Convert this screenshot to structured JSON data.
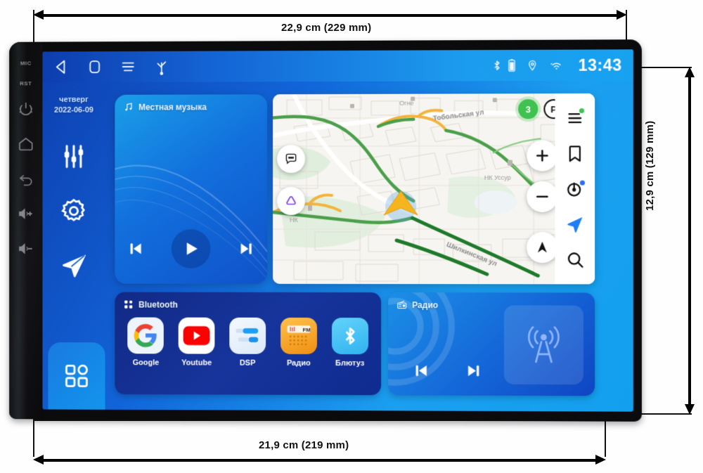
{
  "annotations": {
    "width_top": "22,9 cm (229 mm)",
    "width_bottom": "21,9 cm (219 mm)",
    "height_right": "12,9 cm (129 mm)"
  },
  "device": {
    "hardware_labels": {
      "mic": "MIC",
      "reset": "RST"
    },
    "hardware_buttons": [
      {
        "name": "power-button",
        "icon": "power-icon"
      },
      {
        "name": "home-button",
        "icon": "home-icon"
      },
      {
        "name": "back-button",
        "icon": "back-arrow-icon"
      },
      {
        "name": "volume-up-button",
        "icon": "volume-plus-icon"
      },
      {
        "name": "volume-down-button",
        "icon": "volume-minus-icon"
      }
    ]
  },
  "statusbar": {
    "nav_icons": [
      "back-icon",
      "home-icon",
      "menu-icon",
      "usb-icon"
    ],
    "tray_icons": [
      "bluetooth-icon",
      "battery-icon",
      "location-icon",
      "wifi-icon"
    ],
    "clock": "13:43"
  },
  "rail": {
    "date": {
      "weekday": "четверг",
      "date": "2022-06-09"
    },
    "icons": [
      "equalizer-icon",
      "settings-gear-icon",
      "navigation-arrow-icon"
    ],
    "app_drawer": "apps-grid-icon"
  },
  "music_widget": {
    "title": "Местная музыка",
    "header_icon": "music-note-icon",
    "controls": [
      {
        "name": "previous-track-button",
        "icon": "skip-previous-icon"
      },
      {
        "name": "play-button",
        "icon": "play-icon"
      },
      {
        "name": "next-track-button",
        "icon": "skip-next-icon"
      }
    ]
  },
  "map_widget": {
    "streets": [
      "Тобольская ул",
      "Шилкинская ул"
    ],
    "pois": [
      "НК Уссур",
      "НК",
      "Огне"
    ],
    "traffic_badge": "3",
    "parking_badge": "P",
    "left_buttons": [
      {
        "name": "chat-button",
        "icon": "chat-bubble-icon"
      },
      {
        "name": "layers-button",
        "icon": "triangle-rounded-icon"
      }
    ],
    "zoom_buttons": [
      {
        "name": "zoom-in-button",
        "icon": "plus-icon"
      },
      {
        "name": "zoom-out-button",
        "icon": "minus-icon"
      }
    ],
    "compass_button": {
      "name": "compass-button",
      "icon": "compass-arrow-icon"
    },
    "rail_buttons": [
      {
        "name": "menu-button",
        "icon": "menu-lines-icon",
        "badge_color": "#3fc24f"
      },
      {
        "name": "bookmarks-button",
        "icon": "bookmark-icon"
      },
      {
        "name": "alice-assistant-button",
        "icon": "alice-icon",
        "badge_color": "#2b6df5"
      },
      {
        "name": "navigate-button",
        "icon": "navigation-arrow-icon",
        "color": "#1f7ef5"
      },
      {
        "name": "search-button",
        "icon": "search-icon"
      }
    ]
  },
  "apps_widget": {
    "title": "Bluetooth",
    "header_icon": "apps-dots-icon",
    "apps": [
      {
        "label": "Google",
        "icon": "google-icon",
        "bg": "#eef4fb"
      },
      {
        "label": "Youtube",
        "icon": "youtube-icon",
        "bg": "#ffffff"
      },
      {
        "label": "DSP",
        "icon": "dsp-icon",
        "bg": "#e9f2fb"
      },
      {
        "label": "Радио",
        "icon": "fm-radio-icon",
        "bg": "#f5a623"
      },
      {
        "label": "Блютуз",
        "icon": "bluetooth-icon",
        "bg": "#4cc3f5"
      }
    ]
  },
  "radio_widget": {
    "title": "Радио",
    "header_icon": "radio-icon",
    "controls": [
      {
        "name": "radio-previous-button",
        "icon": "skip-previous-icon"
      },
      {
        "name": "radio-next-button",
        "icon": "skip-next-icon"
      }
    ],
    "tower_icon": "radio-tower-icon"
  },
  "colors": {
    "screen_blue_dark": "#0e3fb0",
    "screen_blue_light": "#17a2f0",
    "apps_panel": "#16349b",
    "traffic_green": "#3fc24f",
    "accent_blue": "#1f7ef5",
    "bezel": "#0b0b0d"
  }
}
